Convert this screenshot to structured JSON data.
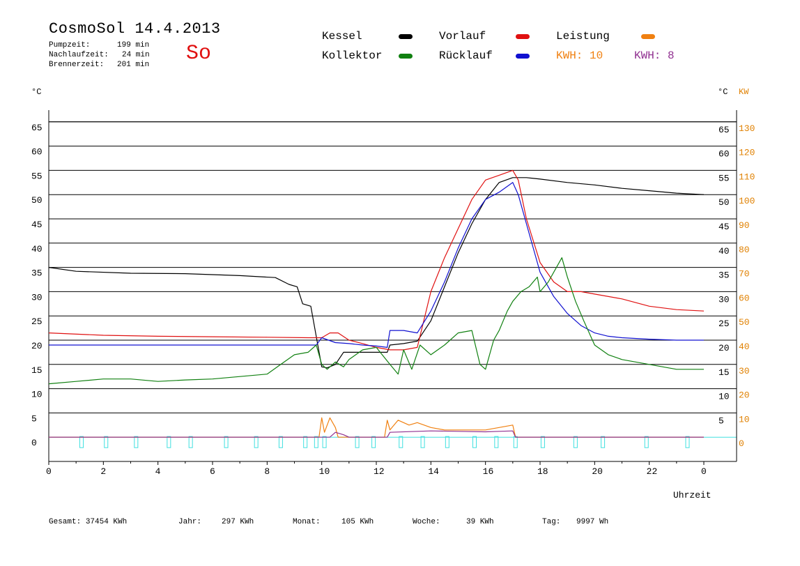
{
  "header": {
    "title": "CosmoSol 14.4.2013",
    "day": "So",
    "stats": [
      {
        "label": "Pumpzeit:",
        "value": "199 min"
      },
      {
        "label": "Nachlaufzeit:",
        "value": "24 min"
      },
      {
        "label": "Brennerzeit:",
        "value": "201 min"
      }
    ]
  },
  "legend": [
    {
      "label": "Kessel",
      "color": "#000000"
    },
    {
      "label": "Kollektor",
      "color": "#108010"
    },
    {
      "label": "Vorlauf",
      "color": "#e01010"
    },
    {
      "label": "Rücklauf",
      "color": "#1010d0"
    },
    {
      "label": "Leistung",
      "color": "#f08010"
    }
  ],
  "kwh": [
    {
      "text": "KWH: 10",
      "color": "#f08010"
    },
    {
      "text": "KWH: 8",
      "color": "#903090"
    }
  ],
  "footer": [
    {
      "label": "Gesamt:",
      "value": "37454 KWh"
    },
    {
      "label": "Jahr:",
      "value": "297 KWh"
    },
    {
      "label": "Monat:",
      "value": "105 KWh"
    },
    {
      "label": "Woche:",
      "value": "39 KWh"
    },
    {
      "label": "Tag:",
      "value": "9997 Wh"
    }
  ],
  "chart_data": {
    "type": "line",
    "xlabel": "Uhrzeit",
    "ylabel_left": "°C",
    "ylabel_right": "°C",
    "ylabel_right2": "KW",
    "xlim": [
      0,
      24
    ],
    "ylim": [
      -5,
      70
    ],
    "x_ticks": [
      "0",
      "2",
      "4",
      "6",
      "8",
      "10",
      "12",
      "14",
      "16",
      "18",
      "20",
      "22",
      "0"
    ],
    "y_ticks": [
      0,
      5,
      10,
      15,
      20,
      25,
      30,
      35,
      40,
      45,
      50,
      55,
      60,
      65
    ],
    "y2_ticks": [
      0,
      10,
      20,
      30,
      40,
      50,
      60,
      70,
      80,
      90,
      100,
      110,
      120,
      130
    ],
    "series": [
      {
        "name": "Kessel",
        "color": "#000000",
        "x": [
          0,
          1,
          3,
          5,
          7,
          8.3,
          8.8,
          9.1,
          9.3,
          9.6,
          10,
          10.2,
          10.5,
          10.8,
          11.5,
          12.4,
          12.5,
          13,
          13.5,
          14,
          14.5,
          15,
          15.5,
          16,
          16.5,
          17,
          17.5,
          18,
          19,
          20,
          21,
          22,
          23,
          24
        ],
        "y": [
          35,
          34.2,
          33.8,
          33.7,
          33.3,
          32.9,
          31.5,
          31,
          27.5,
          27,
          14.5,
          14.3,
          15,
          17.5,
          17.5,
          17.5,
          19,
          19.3,
          19.8,
          24,
          31,
          38,
          44,
          49,
          52.5,
          53.5,
          53.5,
          53.2,
          52.5,
          52,
          51.3,
          50.8,
          50.3,
          50
        ]
      },
      {
        "name": "Vorlauf",
        "color": "#e01010",
        "x": [
          0,
          2,
          4,
          6,
          8,
          9.5,
          10,
          10.3,
          10.6,
          11,
          11.5,
          12,
          12.5,
          13,
          13.5,
          14,
          14.5,
          15,
          15.5,
          16,
          16.5,
          17,
          17.2,
          17.5,
          18,
          18.5,
          19,
          19.5,
          20,
          21,
          22,
          23,
          24
        ],
        "y": [
          21.5,
          21,
          20.8,
          20.7,
          20.6,
          20.5,
          20.5,
          21.5,
          21.5,
          20,
          19.3,
          18.5,
          18,
          18,
          18.5,
          30,
          37,
          43,
          49,
          53,
          54,
          55,
          53,
          45,
          36,
          32,
          30,
          30,
          29.5,
          28.5,
          27,
          26.3,
          26
        ]
      },
      {
        "name": "Rücklauf",
        "color": "#1010d0",
        "x": [
          0,
          2,
          4,
          6,
          8,
          9.8,
          10,
          10.5,
          11,
          11.5,
          12,
          12.4,
          12.5,
          13,
          13.5,
          14,
          14.5,
          15,
          15.5,
          16,
          16.5,
          17,
          17.2,
          17.5,
          18,
          18.5,
          19,
          19.5,
          20,
          20.5,
          21,
          22,
          23,
          24
        ],
        "y": [
          19,
          19,
          19,
          19,
          19,
          19,
          20.5,
          19.5,
          19.3,
          19,
          18.8,
          18.5,
          22,
          22,
          21.5,
          26,
          32,
          39,
          45,
          49,
          50.5,
          52.5,
          50,
          44,
          34,
          29,
          25.5,
          23,
          21.5,
          20.8,
          20.5,
          20.2,
          20,
          20
        ]
      },
      {
        "name": "Kollektor",
        "color": "#108010",
        "x": [
          0,
          1,
          2,
          3,
          4,
          5,
          6,
          7,
          8,
          8.5,
          9,
          9.5,
          9.8,
          10,
          10.2,
          10.5,
          10.8,
          11,
          11.5,
          12,
          12.5,
          12.8,
          13,
          13.3,
          13.6,
          14,
          14.5,
          15,
          15.5,
          15.8,
          16,
          16.3,
          16.5,
          16.8,
          17,
          17.3,
          17.6,
          17.9,
          18,
          18.3,
          18.6,
          18.8,
          19,
          19.3,
          19.6,
          20,
          20.5,
          21,
          22,
          23,
          24
        ],
        "y": [
          11,
          11.5,
          12,
          12,
          11.5,
          11.8,
          12,
          12.5,
          13,
          15,
          17,
          17.5,
          19,
          15,
          14,
          15.5,
          14.5,
          16,
          18,
          18.5,
          15,
          13,
          18,
          14,
          19,
          17,
          19,
          21.5,
          22,
          15,
          14,
          20,
          22,
          26,
          28,
          30,
          31,
          33,
          30,
          32,
          35,
          37,
          33,
          28,
          24,
          19,
          17,
          16,
          15,
          14,
          14
        ]
      },
      {
        "name": "Leistung",
        "color": "#f08010",
        "x": [
          0,
          9.9,
          10,
          10.1,
          10.3,
          10.5,
          10.6,
          12.3,
          12.4,
          12.5,
          12.8,
          13.2,
          13.5,
          14,
          14.5,
          15,
          15.5,
          16,
          16.5,
          17,
          17.1,
          24
        ],
        "y": [
          0,
          0,
          4,
          1,
          4,
          2,
          0,
          0,
          3.5,
          1.5,
          3.5,
          2.5,
          3,
          2,
          1.5,
          1.5,
          1.5,
          1.5,
          2,
          2.5,
          0,
          0
        ]
      },
      {
        "name": "KWH",
        "color": "#903090",
        "x": [
          0,
          10.3,
          10.5,
          10.8,
          11,
          12.4,
          12.5,
          14,
          15,
          16,
          16.5,
          17,
          17.1,
          24
        ],
        "y": [
          0,
          0,
          1,
          0.5,
          0,
          0,
          1,
          1.3,
          1.2,
          1.1,
          1.2,
          1.3,
          0,
          0
        ]
      }
    ],
    "pump_markers_x": [
      1.2,
      2.1,
      3.2,
      4.4,
      5.2,
      6.5,
      7.6,
      8.5,
      9.4,
      9.8,
      10.1,
      11.3,
      11.9,
      12.9,
      13.7,
      14.6,
      15.6,
      16.4,
      17.1,
      18.1,
      19.3,
      20.3,
      21.9,
      23.4
    ],
    "grid": true,
    "legend_position": "top"
  }
}
